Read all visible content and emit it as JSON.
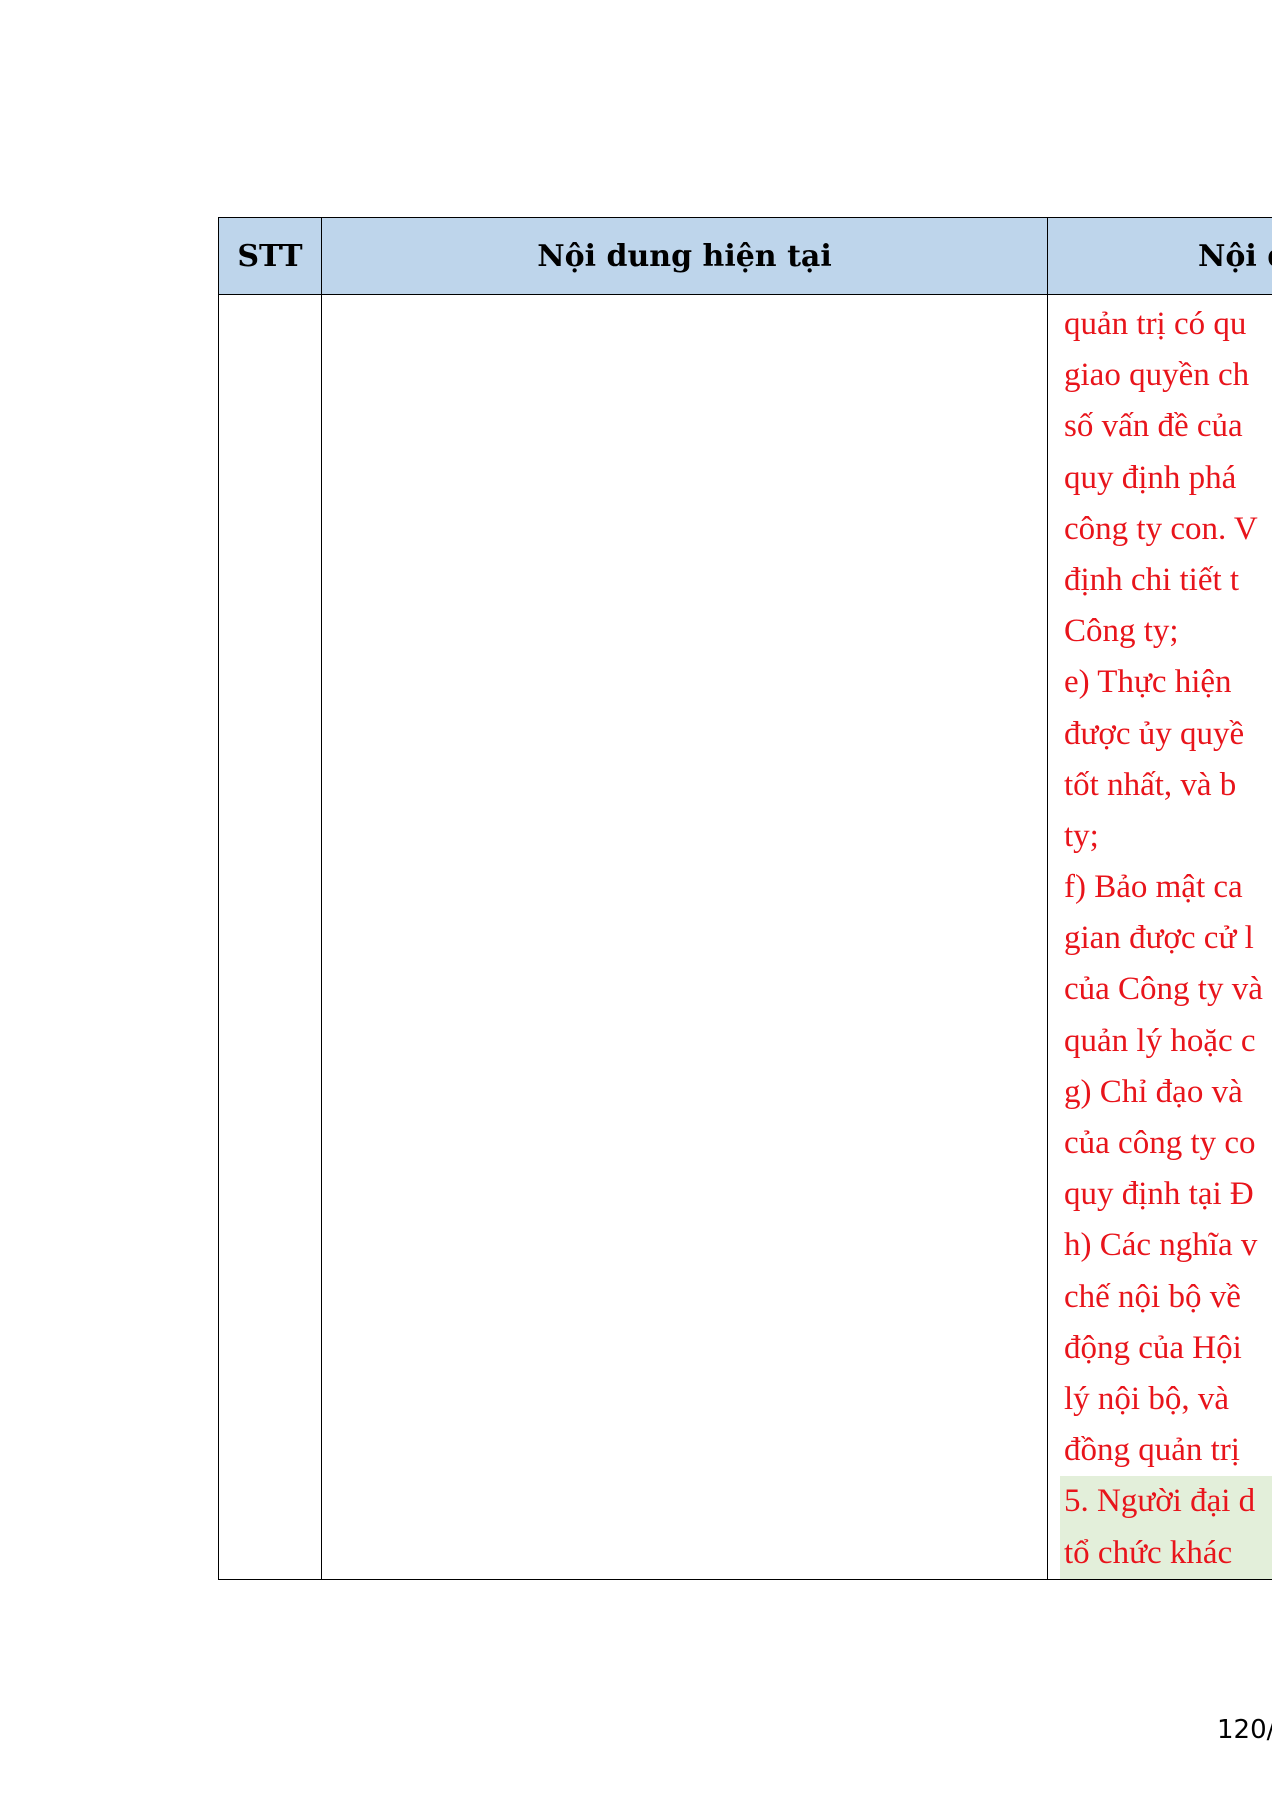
{
  "table": {
    "headers": {
      "stt": "STT",
      "current": "Nội dung hiện tại",
      "new": "Nội d"
    },
    "new_content_lines": [
      "quản trị có qu",
      "giao quyền ch",
      "số vấn đề của",
      "quy định phá",
      "công ty con. V",
      "định chi tiết t",
      "Công ty;",
      "e) Thực hiện",
      "được ủy quyề",
      "tốt nhất, và b",
      "ty;",
      "f) Bảo mật ca",
      "gian được cử l",
      "của Công ty và",
      "quản lý hoặc c",
      "g) Chỉ đạo và",
      "của công ty co",
      "quy định tại Đ",
      "h) Các nghĩa v",
      "chế nội bộ về",
      "động của Hội",
      "lý nội bộ, và",
      "đồng quản trị",
      "5. Người đại d",
      "tổ chức khác"
    ],
    "highlighted_line_indexes": [
      23,
      24
    ]
  },
  "page_number": "120/",
  "colors": {
    "header_background": "#bed5eb",
    "revised_text": "#e8141b",
    "highlight_background": "#e3efda",
    "border": "#000000"
  }
}
